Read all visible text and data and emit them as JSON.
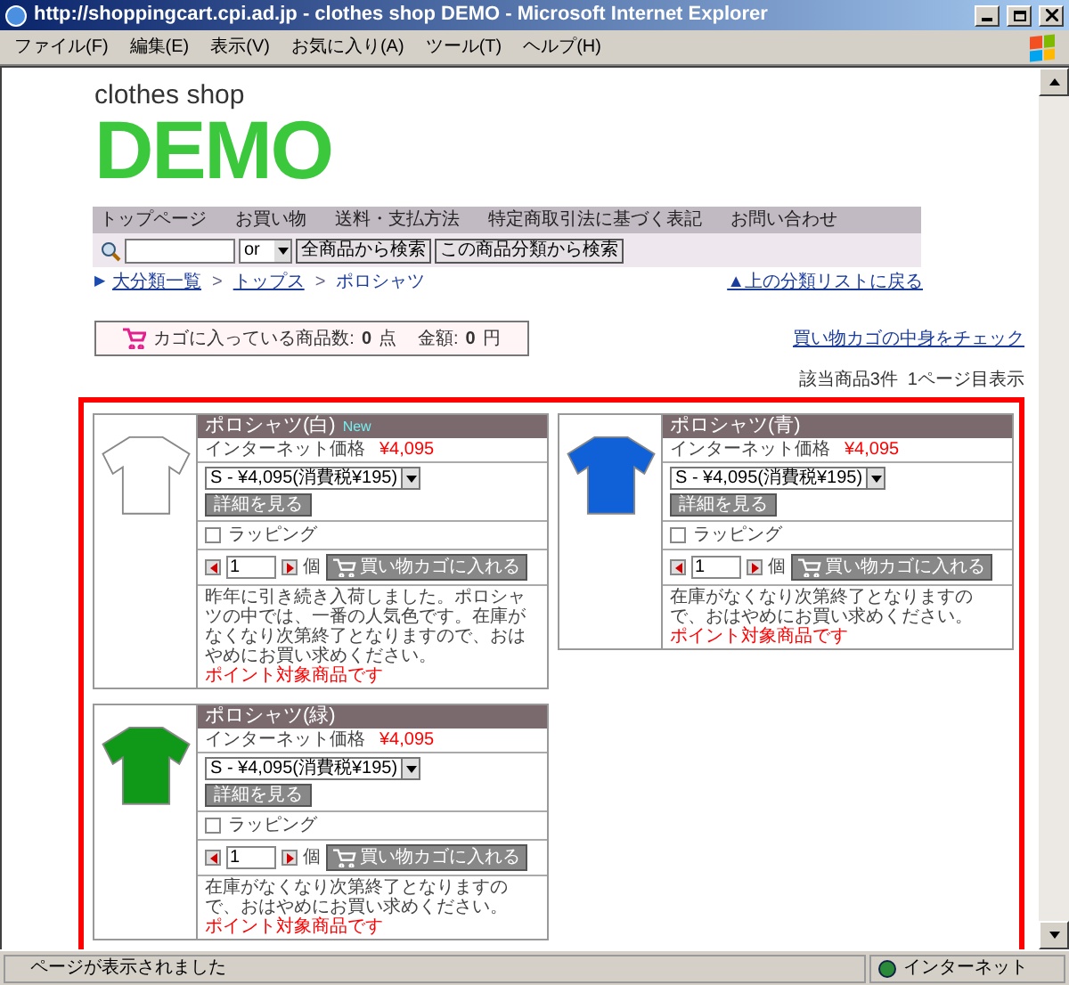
{
  "window": {
    "title": "http://shoppingcart.cpi.ad.jp - clothes shop DEMO - Microsoft Internet Explorer"
  },
  "menu": [
    "ファイル(F)",
    "編集(E)",
    "表示(V)",
    "お気に入り(A)",
    "ツール(T)",
    "ヘルプ(H)"
  ],
  "logo": {
    "small": "clothes shop",
    "big": "DEMO"
  },
  "nav": [
    "トップページ",
    "お買い物",
    "送料・支払方法",
    "特定商取引法に基づく表記",
    "お問い合わせ"
  ],
  "search": {
    "mode": "or",
    "buttons": [
      "全商品から検索",
      "この商品分類から検索"
    ]
  },
  "breadcrumb": {
    "marker": "▶",
    "items": [
      "大分類一覧",
      "トップス",
      "ポロシャツ"
    ],
    "separator": ">",
    "back_link": "▲上の分類リストに戻る"
  },
  "cart": {
    "label": "カゴに入っている商品数:",
    "count": "0",
    "count_unit": "点",
    "amount_label": "金額:",
    "amount": "0",
    "amount_unit": "円",
    "check_link": "買い物カゴの中身をチェック"
  },
  "result_info": "該当商品3件  1ページ目表示",
  "products": [
    {
      "name": "ポロシャツ(白)",
      "badge": "New",
      "color": "#ffffff",
      "price_label": "インターネット価格",
      "price": "¥4,095",
      "option": "S - ¥4,095(消費税¥195)",
      "detail_button": "詳細を見る",
      "wrapping": {
        "label": "ラッピング",
        "checked": false
      },
      "qty": "1",
      "unit": "個",
      "cart_button": "買い物カゴに入れる",
      "description": "昨年に引き続き入荷しました。ポロシャツの中では、一番の人気色です。在庫がなくなり次第終了となりますので、おはやめにお買い求めください。",
      "point": "ポイント対象商品です"
    },
    {
      "name": "ポロシャツ(青)",
      "color": "#1060d8",
      "price_label": "インターネット価格",
      "price": "¥4,095",
      "option": "S - ¥4,095(消費税¥195)",
      "detail_button": "詳細を見る",
      "wrapping": {
        "label": "ラッピング",
        "checked": false
      },
      "qty": "1",
      "unit": "個",
      "cart_button": "買い物カゴに入れる",
      "description": "在庫がなくなり次第終了となりますので、おはやめにお買い求めください。",
      "point": "ポイント対象商品です"
    },
    {
      "name": "ポロシャツ(緑)",
      "color": "#109818",
      "price_label": "インターネット価格",
      "price": "¥4,095",
      "option": "S - ¥4,095(消費税¥195)",
      "detail_button": "詳細を見る",
      "wrapping": {
        "label": "ラッピング",
        "checked": false
      },
      "qty": "1",
      "unit": "個",
      "cart_button": "買い物カゴに入れる",
      "description": "在庫がなくなり次第終了となりますので、おはやめにお買い求めください。",
      "point": "ポイント対象商品です"
    }
  ],
  "status_bar": {
    "text": "ページが表示されました",
    "zone": "インターネット"
  }
}
